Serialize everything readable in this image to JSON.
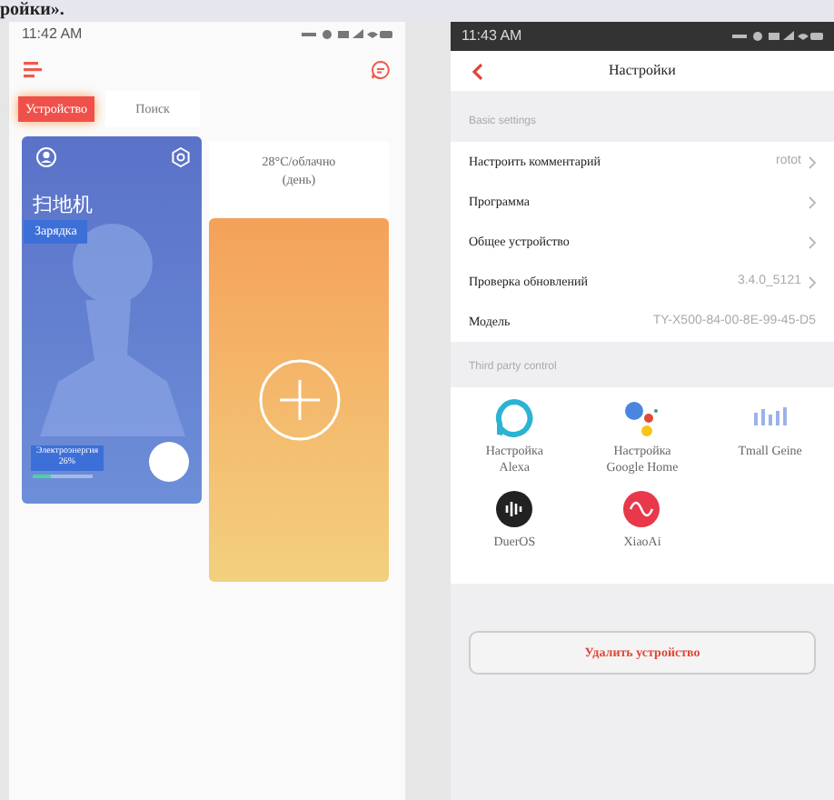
{
  "caption_fragment": "ройки».",
  "left_screen": {
    "status_bar": {
      "time": "11:42 AM"
    },
    "tabs": [
      {
        "label": "Устройство",
        "selected": true
      },
      {
        "label": "Поиск",
        "selected": false
      }
    ],
    "device_card": {
      "name": "扫地机",
      "status": "Зарядка",
      "battery": {
        "label": "Электроэнергия 26%",
        "level": 0.3
      }
    },
    "add_card": {
      "weather": "28°C/облачно (день)"
    }
  },
  "right_screen": {
    "status_bar": {
      "time": "11:43 AM"
    },
    "title": "Настройки",
    "basic_settings": {
      "heading": "Basic settings",
      "rows": [
        {
          "label": "Настроить комментарий",
          "value": "rotot",
          "chevron": true
        },
        {
          "label": "Программа",
          "chevron": true
        },
        {
          "label": "Общее устройство",
          "chevron": true
        },
        {
          "label": "Проверка обновлений",
          "value": "3.4.0_5121",
          "chevron": true
        },
        {
          "label": "Модель",
          "value": "TY-X500-84-00-8E-99-45-D5",
          "chevron": false
        }
      ]
    },
    "third_party_control": {
      "heading": "Third party control",
      "items": [
        {
          "kind": "alexa",
          "label": "Настройка Alexa"
        },
        {
          "kind": "google",
          "label": "Настройка Google Home"
        },
        {
          "kind": "tmall",
          "label": "Tmall Geine"
        },
        {
          "kind": "dueros",
          "label": "DuerOS"
        },
        {
          "kind": "xiaoai",
          "label": "XiaoAi"
        }
      ]
    },
    "delete_button": "Удалить устройство"
  }
}
